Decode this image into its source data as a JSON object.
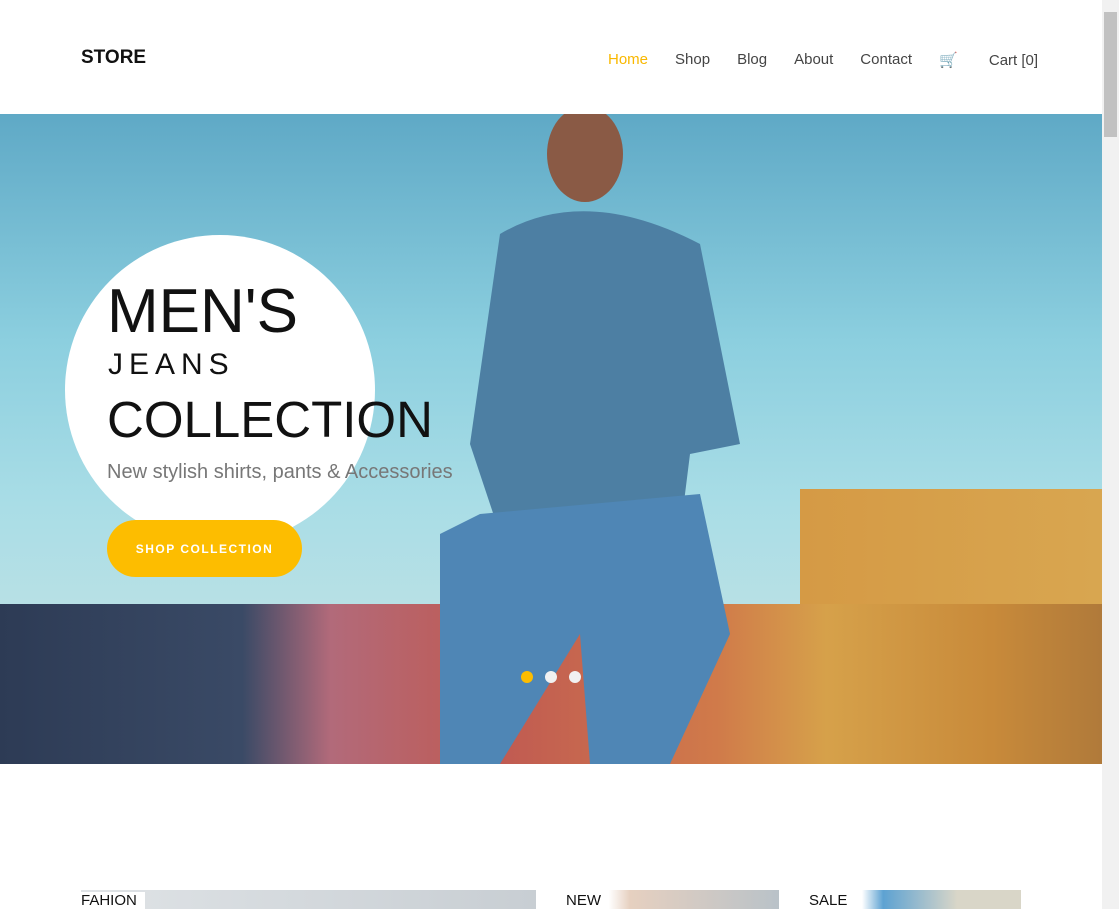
{
  "header": {
    "logo": "STORE",
    "nav": [
      "Home",
      "Shop",
      "Blog",
      "About",
      "Contact"
    ],
    "cart": "Cart [0]",
    "accent": "#fdbd00"
  },
  "hero": {
    "line1": "MEN'S",
    "line2": "JEANS",
    "line3": "COLLECTION",
    "subtitle": "New stylish shirts, pants & Accessories",
    "button": "SHOP COLLECTION",
    "slides": 3,
    "active_slide": 1
  },
  "categories": [
    "FAHION",
    "NEW",
    "SALE"
  ]
}
